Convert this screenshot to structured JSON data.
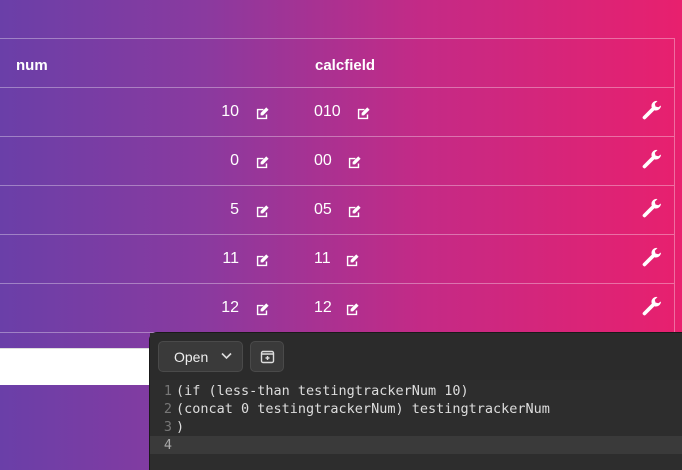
{
  "table": {
    "headers": {
      "num": "num",
      "calcfield": "calcfield"
    },
    "rows": [
      {
        "num": "10",
        "calcfield": "010"
      },
      {
        "num": "0",
        "calcfield": "00"
      },
      {
        "num": "5",
        "calcfield": "05"
      },
      {
        "num": "11",
        "calcfield": "11"
      },
      {
        "num": "12",
        "calcfield": "12"
      }
    ]
  },
  "editor": {
    "open_label": "Open",
    "lines": [
      {
        "n": "1",
        "text": "(if (less-than testingtrackerNum 10)"
      },
      {
        "n": "2",
        "text": "(concat 0 testingtrackerNum) testingtrackerNum"
      },
      {
        "n": "3",
        "text": ")"
      },
      {
        "n": "4",
        "text": ""
      }
    ]
  },
  "icons": {
    "edit": "edit-icon",
    "wrench": "wrench-icon",
    "chevron": "chevron-down-icon",
    "new_tab": "new-tab-icon"
  }
}
